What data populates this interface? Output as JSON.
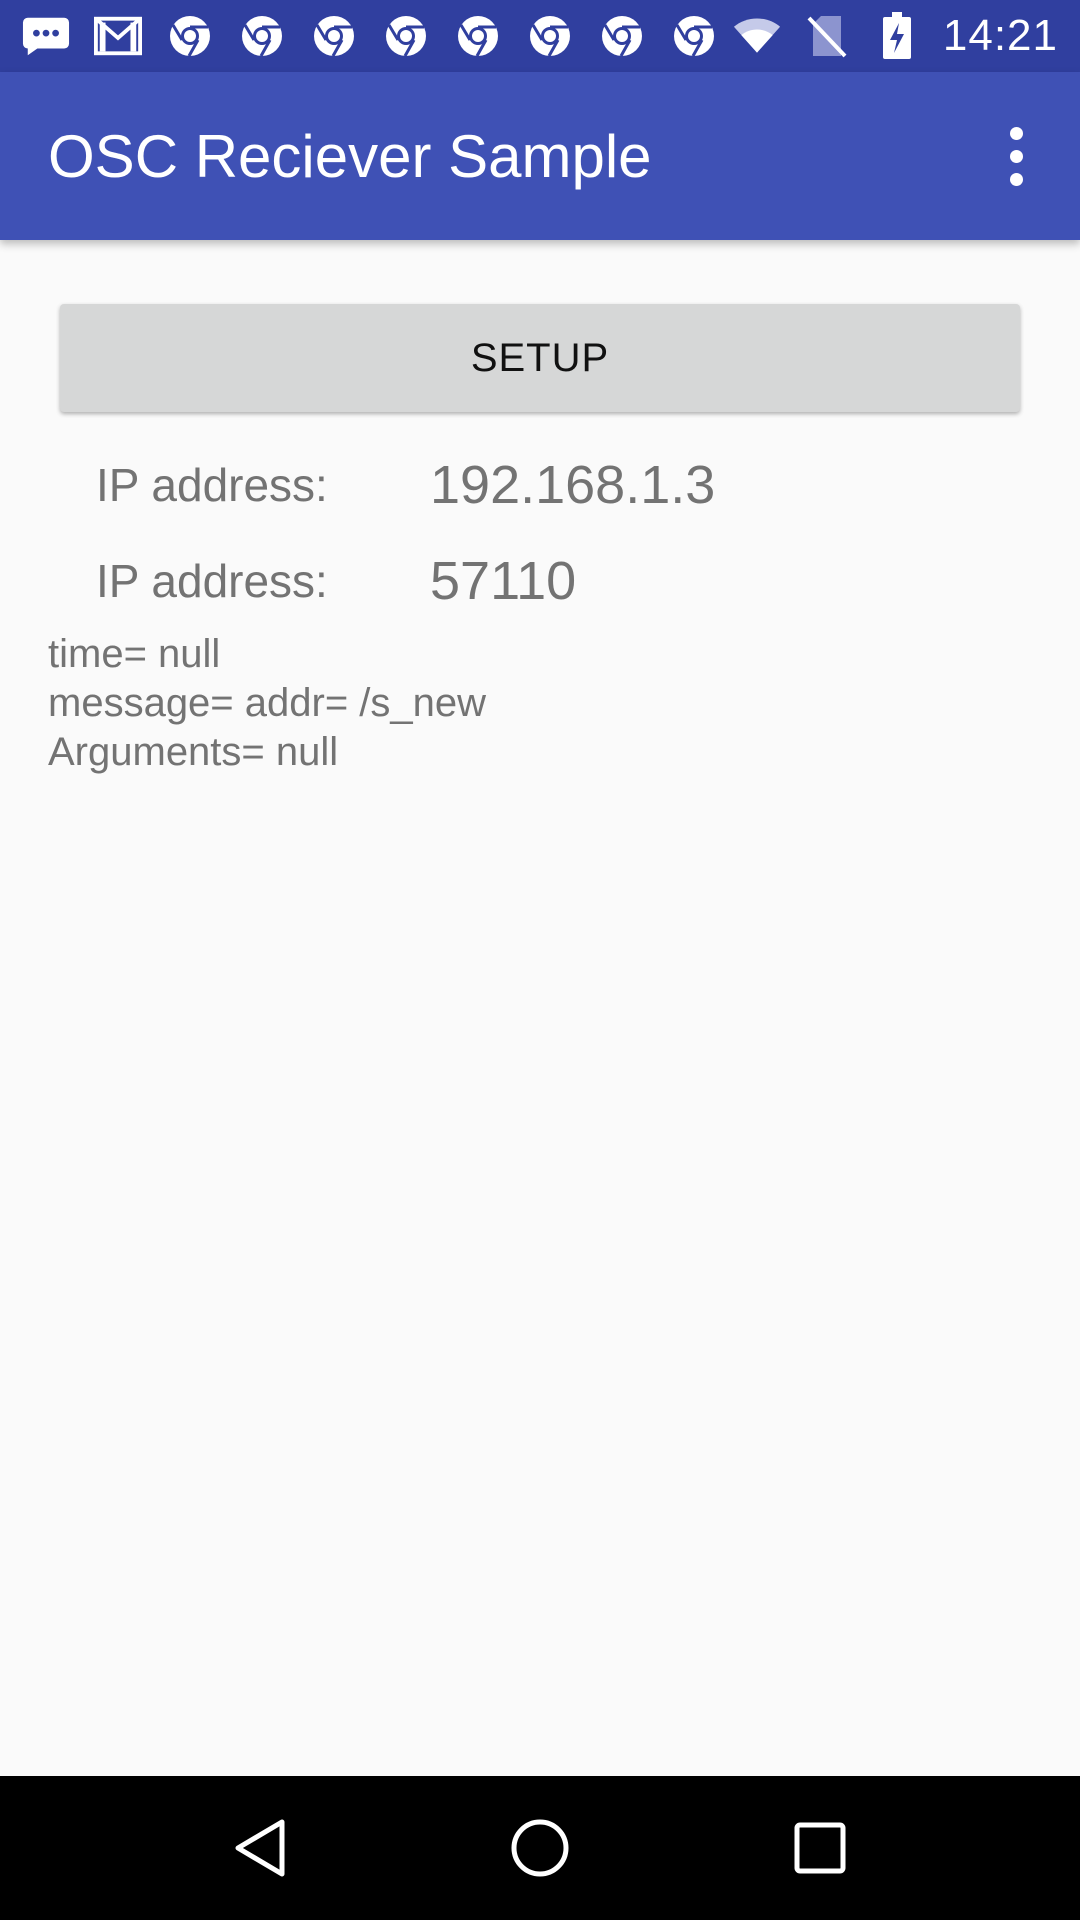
{
  "status_bar": {
    "time": "14:21",
    "notification_icons": [
      "messages-icon",
      "gmail-icon",
      "chrome-icon",
      "chrome-icon",
      "chrome-icon",
      "chrome-icon",
      "chrome-icon",
      "chrome-icon",
      "chrome-icon",
      "chrome-icon"
    ],
    "system_icons": [
      "wifi-icon",
      "no-sim-icon",
      "battery-charging-icon"
    ]
  },
  "app_bar": {
    "title": "OSC Reciever Sample",
    "menu_icon": "more-vert-icon"
  },
  "main": {
    "setup_label": "SETUP",
    "ip_row": {
      "label": "IP address:",
      "value": "192.168.1.3"
    },
    "port_row": {
      "label": "IP address:",
      "value": "57110"
    },
    "log": {
      "time": "time= null",
      "message": "message= addr= /s_new",
      "arguments": "Arguments= null"
    }
  },
  "nav_bar": {
    "back_icon": "back-icon",
    "home_icon": "home-icon",
    "recents_icon": "recents-icon"
  },
  "colors": {
    "status_bar": "#303f9f",
    "app_bar": "#3f51b5",
    "background": "#fafafa",
    "button": "#d6d7d7",
    "nav_bar": "#000000"
  }
}
